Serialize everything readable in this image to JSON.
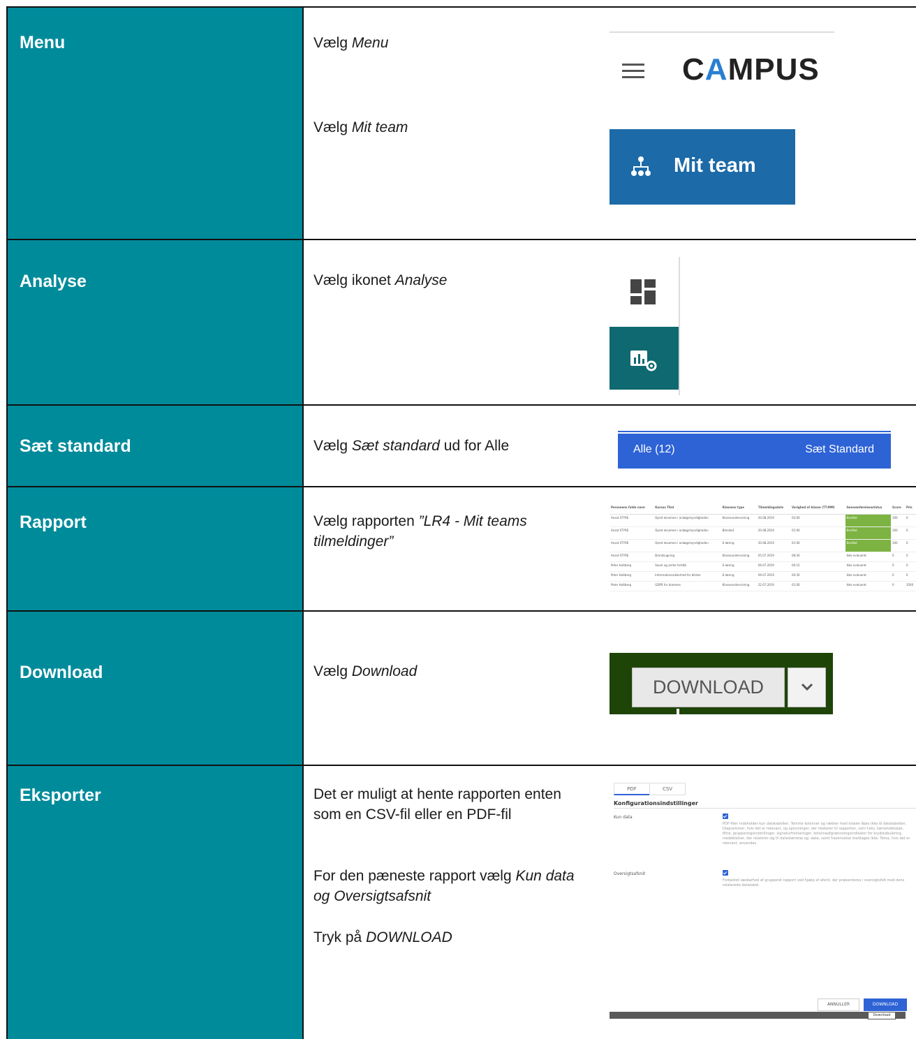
{
  "rows": [
    {
      "label": "Menu",
      "desc_lines": [
        {
          "prefix": "Vælg ",
          "em": "Menu",
          "suffix": ""
        },
        {
          "prefix": "Vælg ",
          "em": "Mit team",
          "suffix": ""
        }
      ],
      "shot": {
        "logo_pre": "C",
        "logo_accent": "A",
        "logo_post": "MPUS",
        "button_label": "Mit team",
        "icons": [
          "hamburger-icon",
          "org-chart-icon"
        ]
      }
    },
    {
      "label": "Analyse",
      "desc_lines": [
        {
          "prefix": "Vælg ikonet ",
          "em": "Analyse",
          "suffix": ""
        }
      ],
      "shot": {
        "icons": [
          "dashboard-icon",
          "analytics-icon"
        ]
      }
    },
    {
      "label": "Sæt standard",
      "desc_lines": [
        {
          "prefix": "Vælg ",
          "em": "Sæt standard",
          "suffix": " ud for Alle"
        }
      ],
      "shot": {
        "left_label": "Alle (12)",
        "right_label": "Sæt Standard"
      }
    },
    {
      "label": "Rapport",
      "desc_lines": [
        {
          "prefix": "Vælg rapporten ",
          "em": "”LR4 - Mit teams tilmeldinger”",
          "suffix": ""
        }
      ],
      "shot": {
        "headers": [
          "Personens fulde navn",
          "Kursus Titel",
          "Klassens type",
          "Tilmeldingsdato",
          "Varighed af klasse (TT:MM)",
          "Gennemførelsesstatus",
          "Score",
          "Pris"
        ],
        "rows": [
          [
            "Ansat STYRE",
            "Opret eksamen i anlægsmyndigheden",
            "Klasseundervisning",
            "20.08.2019",
            "02:00",
            "Bestået",
            "100",
            "0"
          ],
          [
            "Ansat STYRE",
            "Opret eksamen i anlægsmyndigheden",
            "Blended",
            "20.08.2019",
            "01:00",
            "Bestået",
            "100",
            "0"
          ],
          [
            "Ansat STYRE",
            "Opret eksamen i anlægsmyndigheden",
            "E-læring",
            "20.08.2019",
            "01:00",
            "Bestået",
            "100",
            "0"
          ],
          [
            "Ansat STYRE",
            "Brandsugning",
            "Klasseundervisning",
            "05.07.2019",
            "08:30",
            "Ikke evalueret",
            "0",
            "0"
          ],
          [
            "Peter Hultberg",
            "Saver og andre forhåb",
            "E-læring",
            "09.07.2019",
            "00:15",
            "Ikke evalueret",
            "0",
            "0"
          ],
          [
            "Peter Hultberg",
            "Informationssikkerhed for bitster",
            "E-læring",
            "09.07.2019",
            "00:30",
            "Ikke evalueret",
            "0",
            "0"
          ],
          [
            "Peter Hultberg",
            "GDPR for dommes",
            "Klasseundervisning",
            "22.07.2019",
            "01:00",
            "Ikke evalueret",
            "0",
            "3500"
          ]
        ]
      }
    },
    {
      "label": "Download",
      "desc_lines": [
        {
          "prefix": "Vælg ",
          "em": "Download",
          "suffix": ""
        }
      ],
      "shot": {
        "button_label": "DOWNLOAD",
        "icons": [
          "chevron-down-icon"
        ]
      }
    },
    {
      "label": "Eksporter",
      "desc_lines": [
        {
          "prefix": "Det er muligt at hente rapporten enten som en CSV-fil eller en PDF-fil",
          "em": "",
          "suffix": ""
        },
        {
          "prefix": "For den pæneste rapport vælg ",
          "em": "Kun data og Oversigtsafsnit",
          "suffix": ""
        },
        {
          "prefix": "Tryk på ",
          "em": "DOWNLOAD",
          "suffix": ""
        }
      ],
      "shot": {
        "tabs": [
          "PDF",
          "CSV"
        ],
        "section_title": "Konfigurationsindstillinger",
        "options": [
          {
            "label": "Kun data",
            "desc": "PDF-filen indeholder kun datatabellen. Tomme kolonner og rækker med totaler føjes ikke til datatabellen. Diagrammer, hvis det er relevant, og oplysninger, der relaterer til rapporten, som f.eks. kørselsdetaljer, filtre, grupperingsindstillinger, signaturforklaringer, kolonneafgrænsningsindikator for krydstabulering, meddelelser, der relaterer sig til datastørrelse og -data, samt fraskrivelse medtages ikke. Tema, hvis det er relevant, anvendes."
          },
          {
            "label": "Oversigtsafsnit",
            "desc": "Forbedret læsbarhed af grupperet rapport ved hjælp af afsnit, der præsenteres i oversigtsfelt med dens relaterede datatabel."
          }
        ],
        "cancel_label": "ANNULLER",
        "download_label": "DOWNLOAD",
        "tooltip": "Download"
      }
    }
  ],
  "colors": {
    "label_bg": "#008b9b",
    "campus_blue": "#1c6aa7",
    "analyse_teal": "#0e6970",
    "standard_blue": "#2e63d6",
    "download_bg": "#1e4408",
    "status_green": "#7db342"
  }
}
